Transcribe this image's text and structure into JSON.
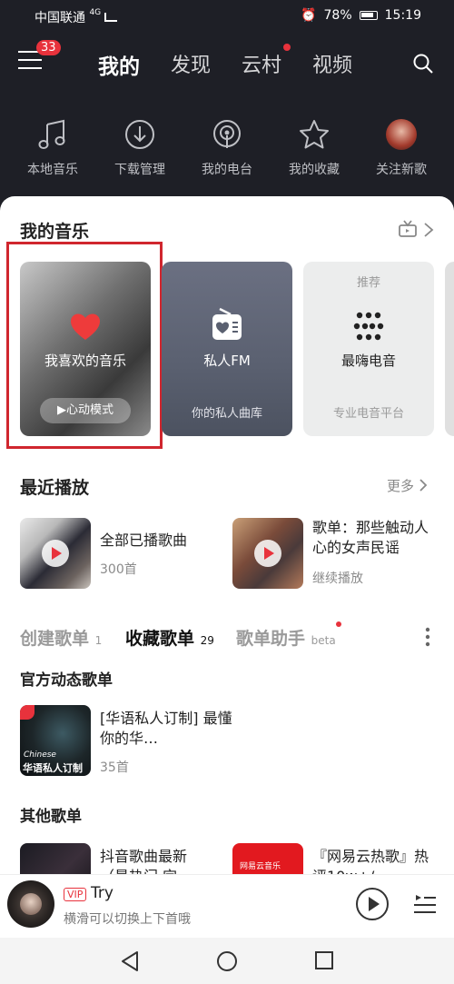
{
  "status": {
    "carrier": "中国联通",
    "network": "4G",
    "battery": "78%",
    "time": "15:19"
  },
  "nav": {
    "menu_badge": "33",
    "tabs": [
      "我的",
      "发现",
      "云村",
      "视频"
    ]
  },
  "quick": [
    {
      "label": "本地音乐",
      "icon": "music-note-icon"
    },
    {
      "label": "下载管理",
      "icon": "download-icon"
    },
    {
      "label": "我的电台",
      "icon": "radio-icon"
    },
    {
      "label": "我的收藏",
      "icon": "star-icon"
    },
    {
      "label": "关注新歌",
      "icon": "avatar-icon"
    }
  ],
  "my_music": {
    "title": "我的音乐",
    "cards": [
      {
        "title": "我喜欢的音乐",
        "button": "▶心动模式"
      },
      {
        "title": "私人FM",
        "sub": "你的私人曲库"
      },
      {
        "tag": "推荐",
        "title": "最嗨电音",
        "sub": "专业电音平台"
      }
    ]
  },
  "recent": {
    "title": "最近播放",
    "more": "更多",
    "items": [
      {
        "title": "全部已播歌曲",
        "sub": "300首"
      },
      {
        "title": "歌单：那些触动人心的女声民谣",
        "sub": "继续播放"
      }
    ]
  },
  "playlist_tabs": [
    {
      "label": "创建歌单",
      "count": "1"
    },
    {
      "label": "收藏歌单",
      "count": "29"
    },
    {
      "label": "歌单助手",
      "count": "beta"
    }
  ],
  "official": {
    "title": "官方动态歌单",
    "item": {
      "cover_text": "华语私人订制",
      "cover_tag": "Chinese",
      "title": "[华语私人订制] 最懂你的华…",
      "sub": "35首"
    }
  },
  "other": {
    "title": "其他歌单",
    "items": [
      {
        "title": "抖音歌曲最新（最热门 完…"
      },
      {
        "cover_text": "网易云音乐",
        "title": "『网易云热歌』热评10w+/…"
      }
    ]
  },
  "player": {
    "vip": "VIP",
    "song": "Try",
    "hint": "横滑可以切换上下首哦"
  },
  "colors": {
    "accent": "#e8323c",
    "dark_bg": "#1e1f26"
  }
}
